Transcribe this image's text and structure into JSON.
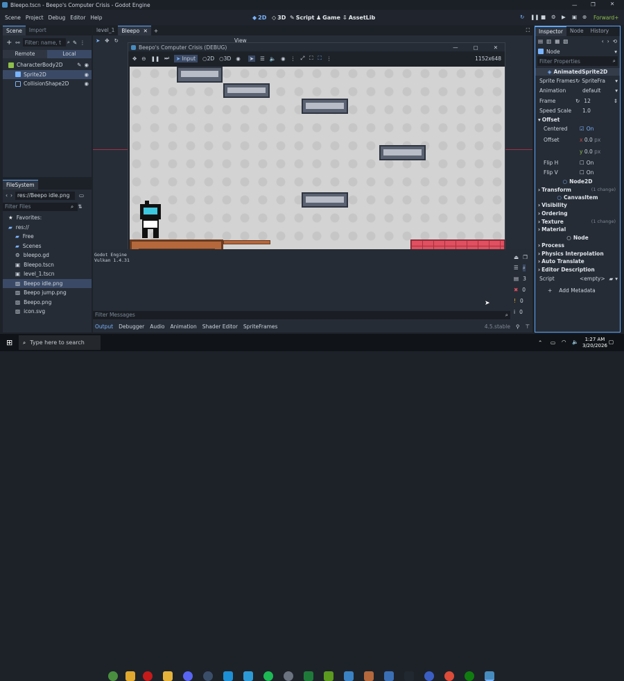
{
  "window": {
    "title": "Bleepo.tscn - Beepo's Computer Crisis - Godot Engine"
  },
  "menu": [
    "Scene",
    "Project",
    "Debug",
    "Editor",
    "Help"
  ],
  "workspaces": [
    {
      "label": "2D",
      "icon": "2d-icon"
    },
    {
      "label": "3D",
      "icon": "3d-icon"
    },
    {
      "label": "Script",
      "icon": "script-icon"
    },
    {
      "label": "Game",
      "icon": "game-icon"
    },
    {
      "label": "AssetLib",
      "icon": "assetlib-icon"
    }
  ],
  "renderer": "Forward+",
  "scene_panel": {
    "tabs": [
      "Scene",
      "Import"
    ],
    "filter_placeholder": "Filter: name, t",
    "subtabs": [
      "Remote",
      "Local"
    ],
    "nodes": [
      {
        "label": "CharacterBody2D",
        "icon": "characterbody2d-icon",
        "color": "#8fbf4b"
      },
      {
        "label": "Sprite2D",
        "icon": "sprite2d-icon",
        "color": "#7ab4ff"
      },
      {
        "label": "CollisionShape2D",
        "icon": "collisionshape2d-icon",
        "color": "#7ab4ff"
      }
    ]
  },
  "filesystem": {
    "title": "FileSystem",
    "path": "res://Beepo idle.png",
    "filter_placeholder": "Filter Files",
    "items": [
      {
        "label": "Favorites:",
        "indent": 0,
        "icon": "star-icon"
      },
      {
        "label": "res://",
        "indent": 0,
        "icon": "folder-icon"
      },
      {
        "label": "Free",
        "indent": 1,
        "icon": "folder-icon"
      },
      {
        "label": "Scenes",
        "indent": 1,
        "icon": "folder-icon"
      },
      {
        "label": "bleepo.gd",
        "indent": 1,
        "icon": "gear-icon"
      },
      {
        "label": "Bleepo.tscn",
        "indent": 1,
        "icon": "scene-icon"
      },
      {
        "label": "level_1.tscn",
        "indent": 1,
        "icon": "scene-icon"
      },
      {
        "label": "Beepo idle.png",
        "indent": 1,
        "icon": "image-icon"
      },
      {
        "label": "Beepo jump.png",
        "indent": 1,
        "icon": "image-icon"
      },
      {
        "label": "Beepo.png",
        "indent": 1,
        "icon": "image-icon"
      },
      {
        "label": "icon.svg",
        "indent": 1,
        "icon": "image-icon"
      }
    ]
  },
  "editor_tabs": [
    "level_1",
    "Bleepo"
  ],
  "view_menu": "View",
  "game_window": {
    "title": "Beepo's Computer Crisis (DEBUG)",
    "toolbar": {
      "input": "Input",
      "2d": "2D",
      "3d": "3D"
    },
    "resolution": "1152x648"
  },
  "output_panel": {
    "log": [
      "Godot Engine",
      "Vulkan 1.4.31"
    ],
    "filter_placeholder": "Filter Messages",
    "tabs": [
      "Output",
      "Debugger",
      "Audio",
      "Animation",
      "Shader Editor",
      "SpriteFrames"
    ],
    "version": "4.5.stable",
    "counts": [
      {
        "icon": "message-icon",
        "value": "3"
      },
      {
        "icon": "error-icon",
        "value": "0"
      },
      {
        "icon": "warning-icon",
        "value": "0"
      },
      {
        "icon": "info-icon",
        "value": "0"
      }
    ]
  },
  "inspector": {
    "tabs": [
      "Inspector",
      "Node",
      "History"
    ],
    "node": "Node",
    "filter_placeholder": "Filter Properties",
    "class": "AnimatedSprite2D",
    "rows": [
      {
        "k": "Sprite Frames",
        "v": "SpriteFra"
      },
      {
        "k": "Animation",
        "v": "default"
      },
      {
        "k": "Frame",
        "v": "12"
      },
      {
        "k": "Speed Scale",
        "v": "1.0"
      }
    ],
    "offset": {
      "title": "Offset",
      "centered_label": "Centered",
      "centered": "On",
      "offset_label": "Offset",
      "x": "0.0",
      "y": "0.0",
      "unit": "px",
      "fliph_label": "Flip H",
      "fliph": "On",
      "flipv_label": "Flip V",
      "flipv": "On"
    },
    "node2d": "Node2D",
    "transform": "Transform",
    "change1": "(1 change)",
    "canvasitem": "CanvasItem",
    "sections": [
      "Visibility",
      "Ordering",
      "Texture",
      "Material"
    ],
    "change2": "(1 change)",
    "sections2": [
      "Process",
      "Physics Interpolation",
      "Auto Translate",
      "Editor Description"
    ],
    "script_label": "Script",
    "script_value": "<empty>",
    "add_metadata": "Add Metadata"
  },
  "taskbar": {
    "search_placeholder": "Type here to search",
    "time": "1:27 AM",
    "date": "3/20/2026"
  }
}
